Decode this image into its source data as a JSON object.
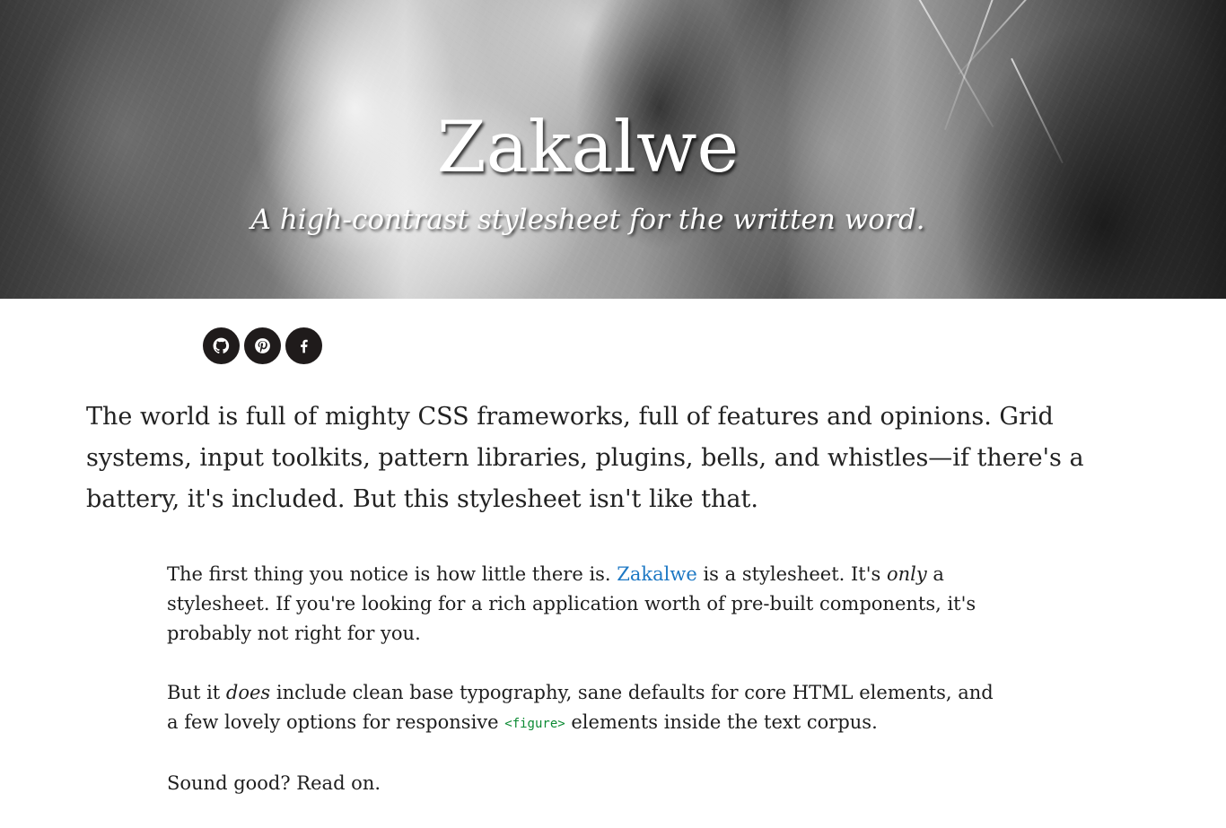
{
  "hero": {
    "title": "Zakalwe",
    "subtitle": "A high-contrast stylesheet for the written word."
  },
  "social": {
    "items": [
      {
        "icon": "github-icon"
      },
      {
        "icon": "pinterest-icon"
      },
      {
        "icon": "facebook-icon"
      }
    ]
  },
  "content": {
    "lead": "The world is full of mighty CSS frameworks, full of features and opinions. Grid systems, input toolkits, pattern libraries, plugins, bells, and whistles—if there's a battery, it's included. But this stylesheet isn't like that.",
    "paragraphs": [
      {
        "before_link": "The first thing you notice is how little there is. ",
        "link": "Zakalwe",
        "after_link_1": " is a stylesheet. It's ",
        "emphasis": "only",
        "after_link_2": " a stylesheet. If you're looking for a rich application worth of pre-built components, it's probably not right for you."
      },
      {
        "before_emphasis": "But it ",
        "emphasis": "does",
        "after_emphasis": " include clean base typography, sane defaults for core HTML elements, and a few lovely options for responsive ",
        "code": "<figure>",
        "after_code": " elements inside the text corpus."
      },
      {
        "text": "Sound good? Read on."
      }
    ]
  },
  "colors": {
    "link": "#1d78c4",
    "code": "#0b8a33",
    "social_background": "#1f1b1b"
  }
}
